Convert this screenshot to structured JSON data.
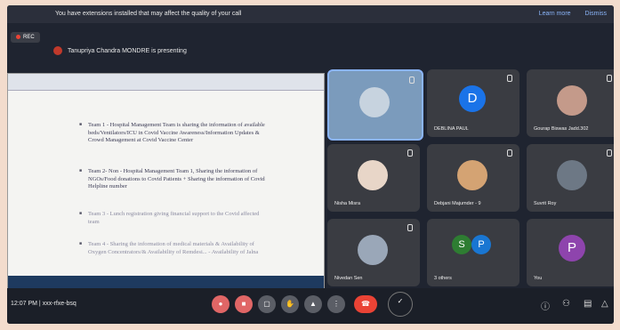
{
  "banner": {
    "message": "You have extensions installed that may affect the quality of your call",
    "learn_more": "Learn more",
    "dismiss": "Dismiss"
  },
  "recording": {
    "label": "REC"
  },
  "presenter": {
    "text": "Tanupriya Chandra MONDRE is presenting"
  },
  "slide": {
    "bullets": [
      "Team 1 - Hospital Management Team is sharing the information of available beds/Ventilators/ICU in Covid Vaccine Awareness/Information Updates & Crowd Management at Covid Vaccine Center",
      "Team 2- Non - Hospital Management Team 1, Sharing the information of NGOs/Food donations to Covid Patients + Sharing the information of Covid Helpline number",
      "Team 3 - Lunch registration giving financial support to the Covid affected team",
      "Team 4 - Sharing the information of medical materials & Availability of Oxygen Concentrators/& Availability of Remdesi... - Availability of Jalna"
    ]
  },
  "participants": [
    {
      "name": "",
      "kind": "video",
      "letter": ""
    },
    {
      "name": "DEBLINA PAUL",
      "kind": "letter",
      "letter": "D",
      "color": "#1a73e8"
    },
    {
      "name": "Gourap Biswas Jadd.302",
      "kind": "video",
      "letter": ""
    },
    {
      "name": "Nisha Misra",
      "kind": "video",
      "letter": ""
    },
    {
      "name": "Debjani Majumder - 9",
      "kind": "video",
      "letter": ""
    },
    {
      "name": "Suvrit Roy",
      "kind": "video",
      "letter": ""
    },
    {
      "name": "Nivedan Sen",
      "kind": "video",
      "letter": ""
    },
    {
      "name": "3 others",
      "kind": "multi",
      "letter": "S P"
    },
    {
      "name": "You",
      "kind": "letter",
      "letter": "P",
      "color": "#8e44ad"
    }
  ],
  "controls": {
    "time": "12:07 PM",
    "meeting_code": "xxx-rfxe-bsq"
  }
}
